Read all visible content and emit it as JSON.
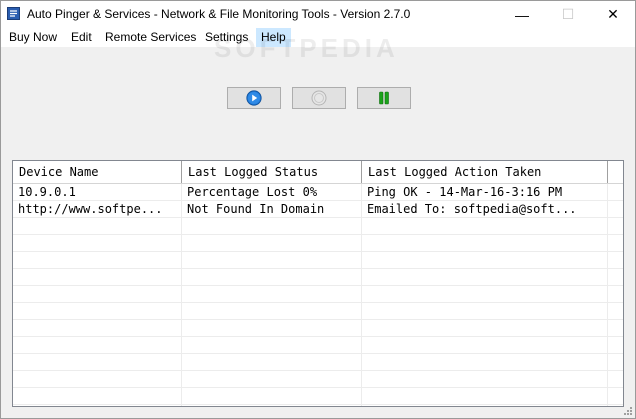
{
  "window": {
    "title": "Auto Pinger & Services - Network & File Monitoring Tools - Version 2.7.0",
    "minimize": "—",
    "maximize": "☐",
    "close": "✕"
  },
  "menu": {
    "items": [
      "Buy Now",
      "Edit",
      "Remote Services",
      "Settings",
      "Help"
    ],
    "active": "Help"
  },
  "watermark": "SOFTPEDIA",
  "toolbar": {
    "start_icon": "play-icon",
    "stop_icon": "stop-icon",
    "pause_icon": "pause-icon"
  },
  "list": {
    "columns": [
      "Device Name",
      "Last Logged Status",
      "Last Logged Action Taken"
    ],
    "rows": [
      [
        "10.9.0.1",
        "Percentage Lost 0%",
        "Ping OK - 14-Mar-16-3:16 PM"
      ],
      [
        "http://www.softpe...",
        "Not Found In Domain",
        "Emailed To: softpedia@soft..."
      ]
    ]
  },
  "colors": {
    "accent_blue": "#1e78d6",
    "pause_green": "#1aa31a",
    "menu_highlight": "#cce8ff"
  }
}
